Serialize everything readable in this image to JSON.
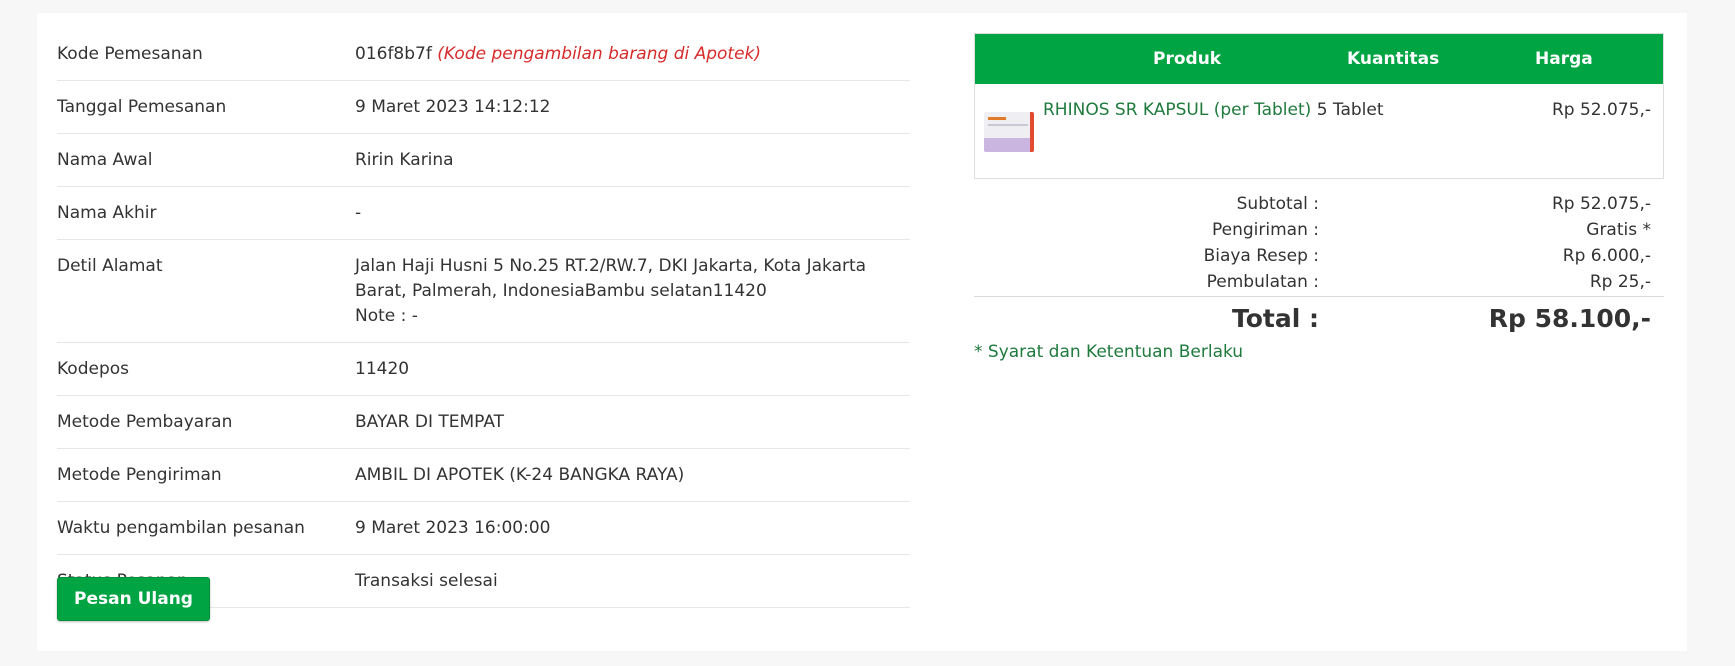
{
  "order_details": {
    "rows": [
      {
        "label": "Kode Pemesanan",
        "value": "016f8b7f",
        "note": "(Kode pengambilan barang di Apotek)"
      },
      {
        "label": "Tanggal Pemesanan",
        "value": "9 Maret 2023 14:12:12"
      },
      {
        "label": "Nama Awal",
        "value": "Ririn Karina"
      },
      {
        "label": "Nama Akhir",
        "value": "-"
      },
      {
        "label": "Detil Alamat",
        "value_line1": "Jalan Haji Husni 5 No.25 RT.2/RW.7, DKI Jakarta, Kota Jakarta",
        "value_line2": "Barat, Palmerah, IndonesiaBambu selatan11420",
        "value_line3": "Note : -"
      },
      {
        "label": "Kodepos",
        "value": "11420"
      },
      {
        "label": "Metode Pembayaran",
        "value": "BAYAR DI TEMPAT"
      },
      {
        "label": "Metode Pengiriman",
        "value": "AMBIL DI APOTEK (K-24 BANGKA RAYA)"
      },
      {
        "label": "Waktu pengambilan pesanan",
        "value": "9 Maret 2023 16:00:00"
      },
      {
        "label": "Status Pesanan",
        "value": "Transaksi selesai"
      }
    ],
    "reorder_button": "Pesan Ulang"
  },
  "summary": {
    "columns": {
      "product": "Produk",
      "quantity": "Kuantitas",
      "price": "Harga"
    },
    "items": [
      {
        "name": "RHINOS SR KAPSUL (per Tablet)",
        "quantity": "5 Tablet",
        "price": "Rp 52.075,-",
        "thumbnail": "product-box-image"
      }
    ],
    "subtotal_label": "Subtotal :",
    "subtotal_value": "Rp 52.075,-",
    "shipping_label": "Pengiriman :",
    "shipping_value": "Gratis *",
    "prescription_label": "Biaya Resep :",
    "prescription_value": "Rp 6.000,-",
    "rounding_label": "Pembulatan :",
    "rounding_value": "Rp 25,-",
    "total_label": "Total :",
    "total_value": "Rp 58.100,-",
    "terms": "* Syarat dan Ketentuan Berlaku"
  },
  "colors": {
    "accent_green": "#00a443",
    "link_green": "#1f7a3d",
    "note_red": "#d62b2b"
  }
}
